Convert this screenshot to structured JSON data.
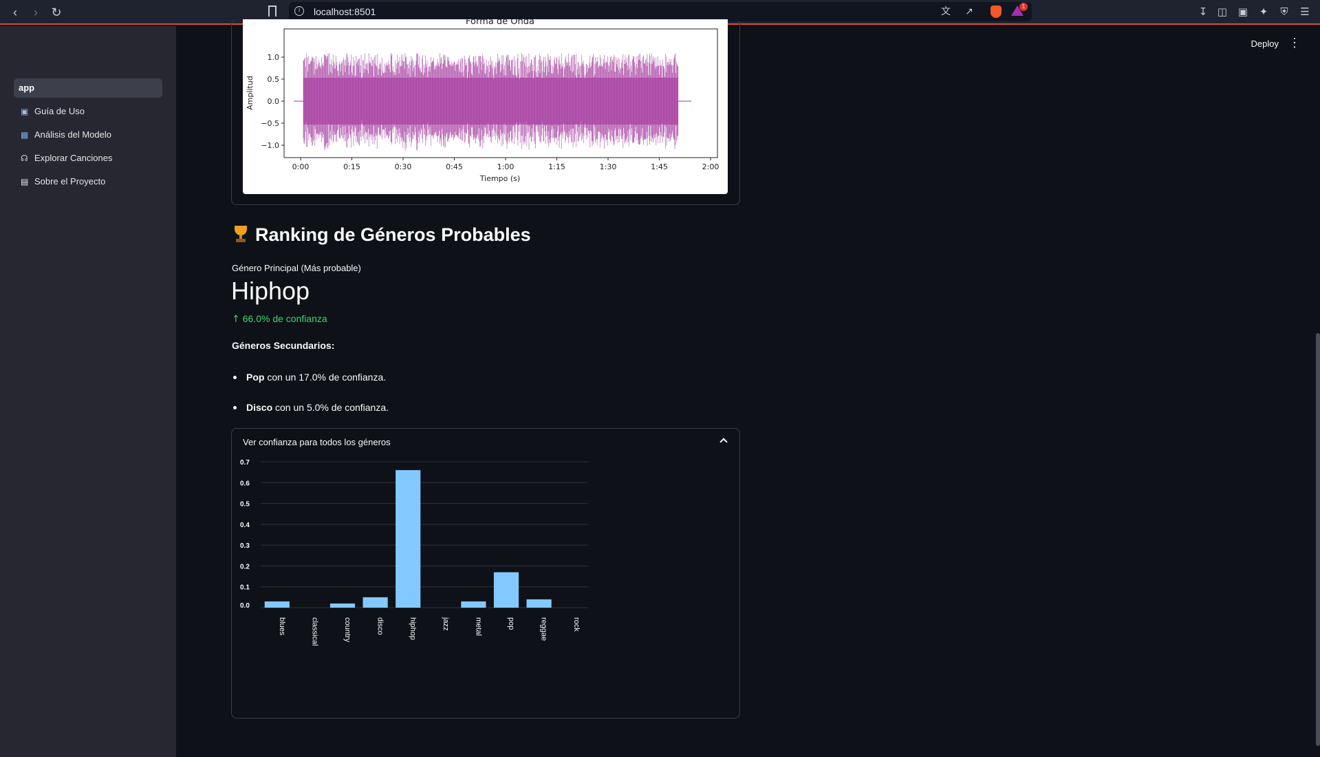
{
  "browser": {
    "url": "localhost:8501",
    "notification_count": "1"
  },
  "header": {
    "deploy_label": "Deploy"
  },
  "sidebar": {
    "items": [
      {
        "label": "app",
        "icon": "",
        "active": true
      },
      {
        "label": "Guía de Uso",
        "icon": "book-icon",
        "active": false
      },
      {
        "label": "Análisis del Modelo",
        "icon": "bar-chart-icon",
        "active": false
      },
      {
        "label": "Explorar Canciones",
        "icon": "headphones-icon",
        "active": false
      },
      {
        "label": "Sobre el Proyecto",
        "icon": "document-icon",
        "active": false
      }
    ]
  },
  "waveform": {
    "title": "Forma de Onda",
    "xlabel": "Tiempo (s)",
    "ylabel": "Amplitud",
    "yticks": [
      "1.0",
      "0.5",
      "0.0",
      "−0.5",
      "−1.0"
    ],
    "xticks": [
      "0:00",
      "0:15",
      "0:30",
      "0:45",
      "1:00",
      "1:15",
      "1:30",
      "1:45",
      "2:00"
    ],
    "color": "#a0309a"
  },
  "ranking": {
    "title": "Ranking de Géneros Probables",
    "metric_label": "Género Principal (Más probable)",
    "metric_value": "Hiphop",
    "metric_delta": "66.0% de confianza",
    "secondary_heading": "Géneros Secundarios:",
    "secondary": [
      {
        "genre": "Pop",
        "text": " con un 17.0% de confianza."
      },
      {
        "genre": "Disco",
        "text": " con un 5.0% de confianza."
      }
    ]
  },
  "expander": {
    "label": "Ver confianza para todos los géneros"
  },
  "chart_data": {
    "type": "bar",
    "categories": [
      "blues",
      "classical",
      "country",
      "disco",
      "hiphop",
      "jazz",
      "metal",
      "pop",
      "reggae",
      "rock"
    ],
    "values": [
      0.03,
      0.0,
      0.02,
      0.05,
      0.66,
      0.0,
      0.03,
      0.17,
      0.04,
      0.0
    ],
    "yticks": [
      "0.0",
      "0.1",
      "0.2",
      "0.3",
      "0.4",
      "0.5",
      "0.6",
      "0.7"
    ],
    "ylim": [
      0,
      0.7
    ],
    "bar_color": "#83c9ff",
    "grid": true
  }
}
